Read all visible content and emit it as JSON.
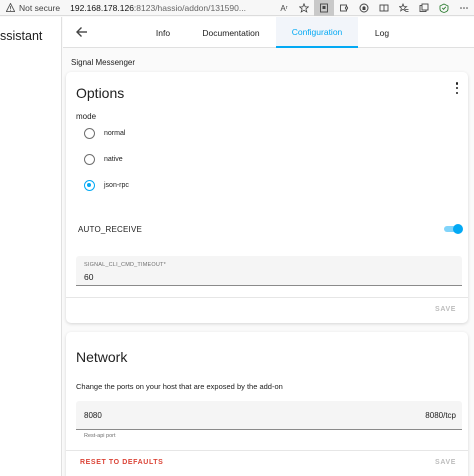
{
  "browser": {
    "security": "Not secure",
    "url_host": "192.168.178.126",
    "url_rest": ":8123/hassio/addon/131590...",
    "read_aloud": "Aʳ"
  },
  "sidebar": {
    "title": "ssistant"
  },
  "tabs": [
    {
      "label": "Info"
    },
    {
      "label": "Documentation"
    },
    {
      "label": "Configuration",
      "selected": true
    },
    {
      "label": "Log"
    }
  ],
  "addon_name": "Signal Messenger",
  "options_card": {
    "title": "Options",
    "mode_label": "mode",
    "modes": [
      {
        "label": "normal",
        "checked": false
      },
      {
        "label": "native",
        "checked": false
      },
      {
        "label": "json-rpc",
        "checked": true
      }
    ],
    "auto_receive": {
      "label": "AUTO_RECEIVE",
      "enabled": true
    },
    "timeout_field": {
      "label": "SIGNAL_CLI_CMD_TIMEOUT*",
      "value": "60"
    },
    "save_label": "SAVE"
  },
  "network_card": {
    "title": "Network",
    "description": "Change the ports on your host that are exposed by the add-on",
    "port_field": {
      "value": "8080",
      "suffix": "8080/tcp",
      "helper": "Rest-api port"
    },
    "reset_label": "RESET TO DEFAULTS",
    "save_label": "SAVE"
  },
  "colors": {
    "accent": "#03a9f4",
    "danger": "#db4437"
  }
}
